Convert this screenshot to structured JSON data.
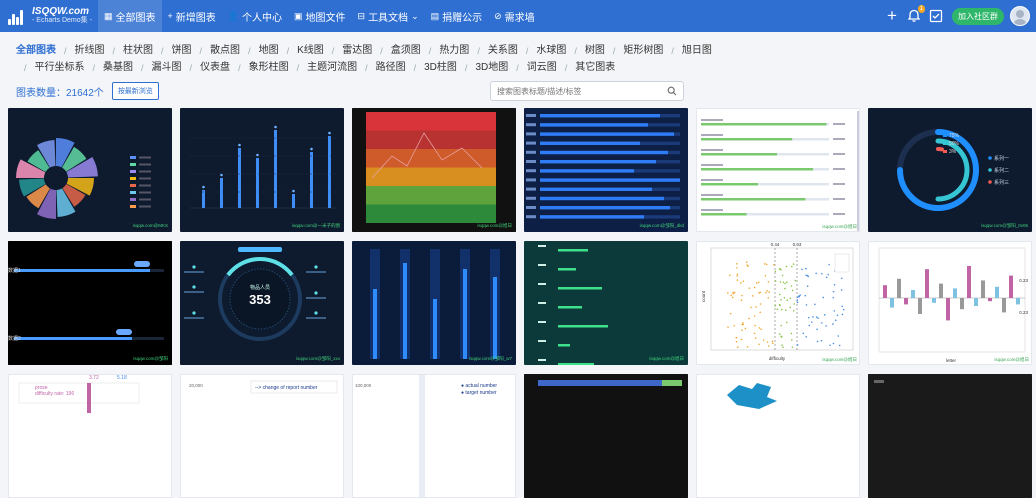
{
  "header": {
    "logo_title": "ISQQW.com",
    "logo_subtitle": "- Echarts Demo集 -",
    "nav": [
      {
        "label": "全部图表",
        "icon": "grid-icon"
      },
      {
        "label": "新增图表",
        "icon": "plus-icon"
      },
      {
        "label": "个人中心",
        "icon": "person-icon"
      },
      {
        "label": "地图文件",
        "icon": "map-icon"
      },
      {
        "label": "工具文档",
        "icon": "toolbox-icon"
      },
      {
        "label": "捐赠公示",
        "icon": "gift-icon"
      },
      {
        "label": "需求墙",
        "icon": "target-icon"
      }
    ],
    "notification_count": "1",
    "join_label": "加入社区群"
  },
  "categories_row1": [
    "全部图表",
    "折线图",
    "柱状图",
    "饼图",
    "散点图",
    "地图",
    "K线图",
    "雷达图",
    "盒须图",
    "热力图",
    "关系图",
    "水球图",
    "树图",
    "矩形树图",
    "旭日图"
  ],
  "categories_row2": [
    "平行坐标系",
    "桑基图",
    "漏斗图",
    "仪表盘",
    "象形柱图",
    "主题河流图",
    "路径图",
    "3D柱图",
    "3D地图",
    "词云图",
    "其它图表"
  ],
  "count_label": "图表数量：",
  "count_value": "21642个",
  "sort_button": "按最新浏览",
  "search": {
    "placeholder": "搜索图表标题/描述/标签"
  },
  "colors": {
    "brand": "#2f6fd1",
    "join": "#2eb76a",
    "badge": "#f5a623"
  },
  "cards": [
    {
      "theme": "dark",
      "kind": "rose",
      "watermark": "isqqw.com@MKS"
    },
    {
      "theme": "dark",
      "kind": "thin-bars",
      "watermark": "isqqw.com@一米子的图"
    },
    {
      "theme": "color",
      "kind": "bands",
      "watermark": "isqqw.com@旭日"
    },
    {
      "theme": "blue",
      "kind": "hbars",
      "watermark": "isqqw.com@邹阳_dkd"
    },
    {
      "theme": "light",
      "kind": "progress",
      "watermark": "isqqw.com@旭日"
    },
    {
      "theme": "dark",
      "kind": "ring",
      "watermark": "isqqw.com@邹阳_0v06",
      "legend": [
        "75%",
        "50%",
        "3%"
      ],
      "series": [
        "系列一",
        "系列二",
        "系列三"
      ]
    },
    {
      "theme": "dark",
      "kind": "bars2",
      "label1": "数据1",
      "label2": "数据2",
      "watermark": "isqqw.com@邹阳"
    },
    {
      "theme": "dark",
      "kind": "gauge",
      "center_label": "物品人员",
      "center_value": "353",
      "watermark": "isqqw.com@邹阳_xxx"
    },
    {
      "theme": "navy",
      "kind": "pillars",
      "watermark": "isqqw.com@邹阳_w7"
    },
    {
      "theme": "teal",
      "kind": "green-bars",
      "watermark": "isqqw.com@旭日"
    },
    {
      "theme": "light",
      "kind": "strip",
      "axis_title": "difficulty",
      "y_title": "count",
      "ticks": [
        "0.44",
        "0.63"
      ],
      "watermark": "isqqw.com@旭日"
    },
    {
      "theme": "light",
      "kind": "diverging",
      "axis_title": "letter",
      "ticks": [
        "0.23",
        "0.23"
      ],
      "watermark": "isqqw.com@旭日"
    },
    {
      "theme": "light",
      "kind": "partial-pink",
      "texts": [
        "prose",
        "difficulty rate: 196",
        "3.72",
        "5.18"
      ]
    },
    {
      "theme": "light",
      "kind": "partial-line",
      "texts": [
        "--> change of report number",
        "20,000"
      ]
    },
    {
      "theme": "light",
      "kind": "partial-legend",
      "texts": [
        "● actual number",
        "● target number",
        "100,000"
      ]
    },
    {
      "theme": "dark",
      "kind": "partial-bar"
    },
    {
      "theme": "light",
      "kind": "partial-map"
    },
    {
      "theme": "dark",
      "kind": "partial-dark"
    }
  ]
}
